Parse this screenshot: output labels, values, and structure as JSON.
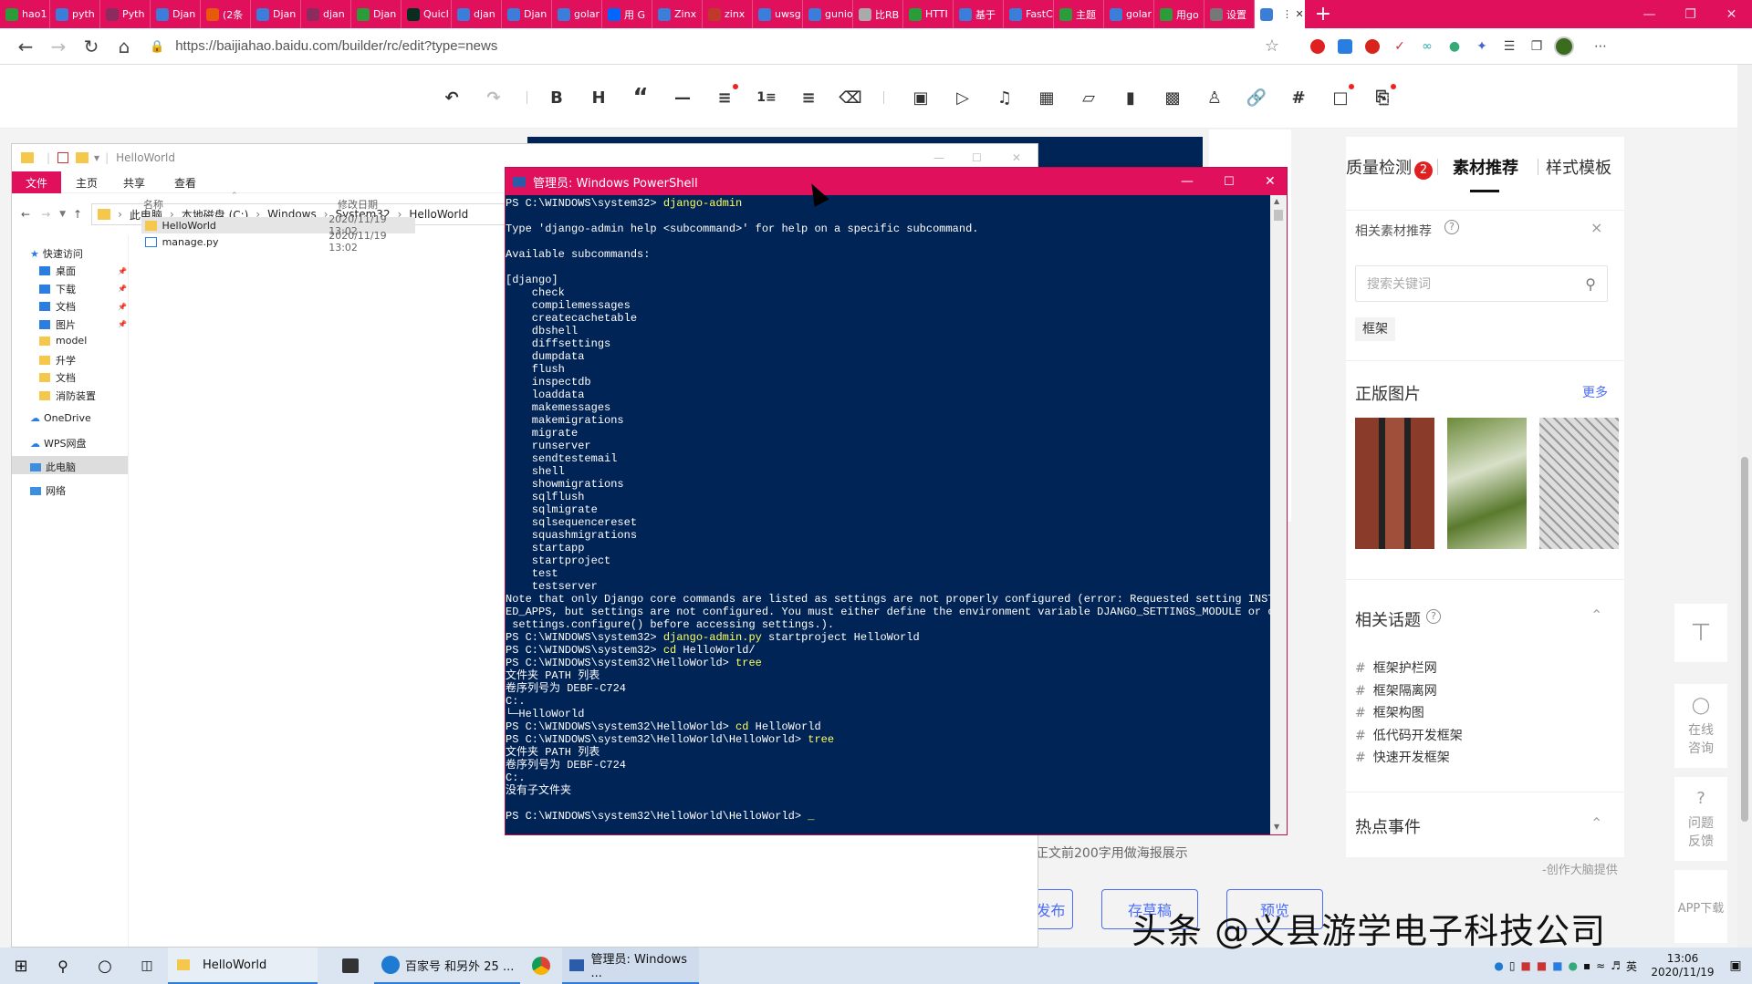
{
  "browser": {
    "tabs": [
      {
        "label": "hao1",
        "color": "#2a9d3a",
        "icon": "frog-icon"
      },
      {
        "label": "pyth",
        "color": "#3b7dd8",
        "icon": "paw-icon"
      },
      {
        "label": "Pyth",
        "color": "#8b2b5e",
        "icon": "logo-icon"
      },
      {
        "label": "Djan",
        "color": "#3b7dd8",
        "icon": "paw-icon"
      },
      {
        "label": "(2条",
        "color": "#e8590c",
        "icon": "c-icon"
      },
      {
        "label": "Djan",
        "color": "#3b7dd8",
        "icon": "paw-icon"
      },
      {
        "label": "djan",
        "color": "#8b2b5e",
        "icon": "logo-icon"
      },
      {
        "label": "Djan",
        "color": "#2a9d3a",
        "icon": "chat-icon"
      },
      {
        "label": "Quicl",
        "color": "#092e20",
        "icon": "dj-icon"
      },
      {
        "label": "djan",
        "color": "#3b7dd8",
        "icon": "bing-icon"
      },
      {
        "label": "Djan",
        "color": "#3b7dd8",
        "icon": "bing-icon"
      },
      {
        "label": "golar",
        "color": "#3b7dd8",
        "icon": "bing-icon"
      },
      {
        "label": "用 G",
        "color": "#0066ff",
        "icon": "zhihu-icon"
      },
      {
        "label": "Zinx",
        "color": "#3b7dd8",
        "icon": "bing-icon"
      },
      {
        "label": "zinx",
        "color": "#c0392b",
        "icon": "g-icon"
      },
      {
        "label": "uwsg",
        "color": "#3b7dd8",
        "icon": "bing-icon"
      },
      {
        "label": "gunio",
        "color": "#3b7dd8",
        "icon": "bing-icon"
      },
      {
        "label": "比RB",
        "color": "#aaaaaa",
        "icon": "doc-icon"
      },
      {
        "label": "HTTI",
        "color": "#2a9d3a",
        "icon": "circle-icon"
      },
      {
        "label": "基于",
        "color": "#3b7dd8",
        "icon": "bing-icon"
      },
      {
        "label": "FastC",
        "color": "#3b7dd8",
        "icon": "paw-icon"
      },
      {
        "label": "主题",
        "color": "#2a9d3a",
        "icon": "chat-icon"
      },
      {
        "label": "golar",
        "color": "#3b7dd8",
        "icon": "blog-icon"
      },
      {
        "label": "用go",
        "color": "#2a9d3a",
        "icon": "chat-icon"
      },
      {
        "label": "设置",
        "color": "#777777",
        "icon": "gear-icon"
      },
      {
        "label": "",
        "color": "#3b7dd8",
        "icon": "paw-icon",
        "active": true
      }
    ],
    "url": "https://baijiahao.baidu.com/builder/rc/edit?type=news"
  },
  "right_panel": {
    "tabs": {
      "quality": "质量检测",
      "quality_badge": "2",
      "material": "素材推荐",
      "style": "样式模板"
    },
    "related_material": "相关素材推荐",
    "search_placeholder": "搜索关键词",
    "tag": "框架",
    "images_title": "正版图片",
    "more": "更多",
    "topics_title": "相关话题",
    "topics": [
      "框架护栏网",
      "框架隔离网",
      "框架构图",
      "低代码开发框架",
      "快速开发框架"
    ],
    "hot_title": "热点事件",
    "credit": "-创作大脑提供"
  },
  "float_buttons": {
    "consult": "在线咨询",
    "feedback": "问题反馈",
    "app": "APP下载"
  },
  "editor": {
    "poster_hint": "正文前200字用做海报展示",
    "publish": "发布",
    "save_draft": "存草稿",
    "preview": "预览"
  },
  "explorer": {
    "title": "HelloWorld",
    "ribbon": [
      "文件",
      "主页",
      "共享",
      "查看"
    ],
    "breadcrumb": [
      "此电脑",
      "本地磁盘 (C:)",
      "Windows",
      "System32",
      "HelloWorld"
    ],
    "col_name": "名称",
    "col_date": "修改日期",
    "files": [
      {
        "name": "HelloWorld",
        "date": "2020/11/19 13:02",
        "type": "folder"
      },
      {
        "name": "manage.py",
        "date": "2020/11/19 13:02",
        "type": "file"
      }
    ],
    "quick_access": "快速访问",
    "nav": [
      {
        "label": "桌面",
        "pinned": true
      },
      {
        "label": "下载",
        "pinned": true
      },
      {
        "label": "文档",
        "pinned": true
      },
      {
        "label": "图片",
        "pinned": true
      },
      {
        "label": "model",
        "pinned": false
      },
      {
        "label": "升学",
        "pinned": false
      },
      {
        "label": "文档",
        "pinned": false
      },
      {
        "label": "消防装置",
        "pinned": false
      }
    ],
    "onedrive": "OneDrive",
    "wps": "WPS网盘",
    "thispc": "此电脑",
    "network": "网络"
  },
  "powershell": {
    "title": "管理员: Windows PowerShell",
    "lines": [
      {
        "t": "PS C:\\WINDOWS\\system32> ",
        "c": "django-admin"
      },
      {
        "t": ""
      },
      {
        "t": "Type 'django-admin help <subcommand>' for help on a specific subcommand."
      },
      {
        "t": ""
      },
      {
        "t": "Available subcommands:"
      },
      {
        "t": ""
      },
      {
        "t": "[django]"
      },
      {
        "t": "    check"
      },
      {
        "t": "    compilemessages"
      },
      {
        "t": "    createcachetable"
      },
      {
        "t": "    dbshell"
      },
      {
        "t": "    diffsettings"
      },
      {
        "t": "    dumpdata"
      },
      {
        "t": "    flush"
      },
      {
        "t": "    inspectdb"
      },
      {
        "t": "    loaddata"
      },
      {
        "t": "    makemessages"
      },
      {
        "t": "    makemigrations"
      },
      {
        "t": "    migrate"
      },
      {
        "t": "    runserver"
      },
      {
        "t": "    sendtestemail"
      },
      {
        "t": "    shell"
      },
      {
        "t": "    showmigrations"
      },
      {
        "t": "    sqlflush"
      },
      {
        "t": "    sqlmigrate"
      },
      {
        "t": "    sqlsequencereset"
      },
      {
        "t": "    squashmigrations"
      },
      {
        "t": "    startapp"
      },
      {
        "t": "    startproject"
      },
      {
        "t": "    test"
      },
      {
        "t": "    testserver"
      },
      {
        "t": "Note that only Django core commands are listed as settings are not properly configured (error: Requested setting INSTALL"
      },
      {
        "t": "ED_APPS, but settings are not configured. You must either define the environment variable DJANGO_SETTINGS_MODULE or call"
      },
      {
        "t": " settings.configure() before accessing settings.)."
      },
      {
        "t": "PS C:\\WINDOWS\\system32> ",
        "c": "django-admin.py",
        "r": " startproject HelloWorld"
      },
      {
        "t": "PS C:\\WINDOWS\\system32> ",
        "c": "cd",
        "r": " HelloWorld/"
      },
      {
        "t": "PS C:\\WINDOWS\\system32\\HelloWorld> ",
        "c": "tree"
      },
      {
        "t": "文件夹 PATH 列表"
      },
      {
        "t": "卷序列号为 DEBF-C724"
      },
      {
        "t": "C:."
      },
      {
        "t": "└─HelloWorld"
      },
      {
        "t": "PS C:\\WINDOWS\\system32\\HelloWorld> ",
        "c": "cd",
        "r": " HelloWorld"
      },
      {
        "t": "PS C:\\WINDOWS\\system32\\HelloWorld\\HelloWorld> ",
        "c": "tree"
      },
      {
        "t": "文件夹 PATH 列表"
      },
      {
        "t": "卷序列号为 DEBF-C724"
      },
      {
        "t": "C:."
      },
      {
        "t": "没有子文件夹"
      },
      {
        "t": ""
      },
      {
        "t": "PS C:\\WINDOWS\\system32\\HelloWorld\\HelloWorld> "
      }
    ]
  },
  "taskbar": {
    "explorer_label": "HelloWorld",
    "edge_label": "百家号 和另外 25 ...",
    "ps_label": "管理员: Windows ...",
    "time": "13:06",
    "date": "2020/11/19",
    "ime": "英"
  },
  "watermark": "头条 @义县游学电子科技公司"
}
